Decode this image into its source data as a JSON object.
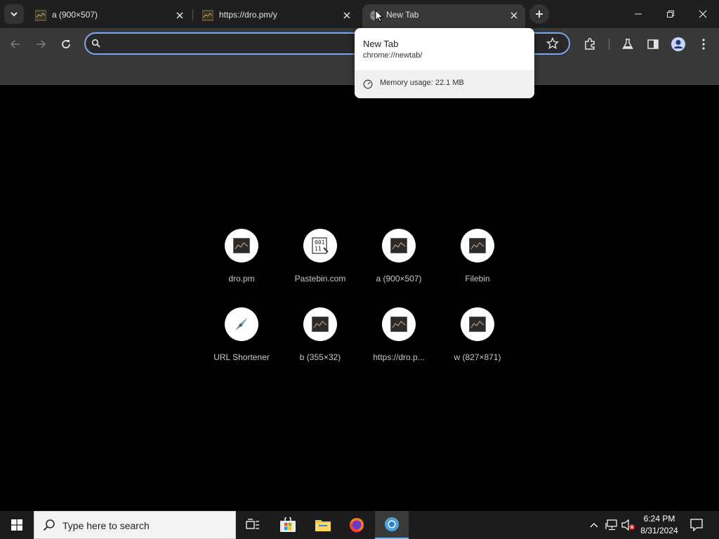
{
  "browser": {
    "tabs": [
      {
        "title": "a (900×507)",
        "active": false
      },
      {
        "title": "https://dro.pm/y",
        "active": false
      },
      {
        "title": "New Tab",
        "active": true
      }
    ],
    "omnibox": {
      "value": "",
      "focus_color": "#7ca5f2"
    }
  },
  "hover_card": {
    "title": "New Tab",
    "url": "chrome://newtab/",
    "memory": "Memory usage: 22.1 MB"
  },
  "shortcuts": [
    {
      "label": "dro.pm",
      "icon": "dro-thumbnail-icon"
    },
    {
      "label": "Pastebin.com",
      "icon": "pastebin-icon"
    },
    {
      "label": "a (900×507)",
      "icon": "image-thumbnail-icon"
    },
    {
      "label": "Filebin",
      "icon": "filebin-thumbnail-icon"
    },
    {
      "label": "URL Shortener",
      "icon": "url-shortener-icon"
    },
    {
      "label": "b (355×32)",
      "icon": "image-thumbnail-icon"
    },
    {
      "label": "https://dro.p...",
      "icon": "dro-thumbnail-icon"
    },
    {
      "label": "w (827×871)",
      "icon": "image-thumbnail-icon"
    }
  ],
  "taskbar": {
    "search_placeholder": "Type here to search",
    "time": "6:24 PM",
    "date": "8/31/2024",
    "accent": "#76b9ed"
  }
}
